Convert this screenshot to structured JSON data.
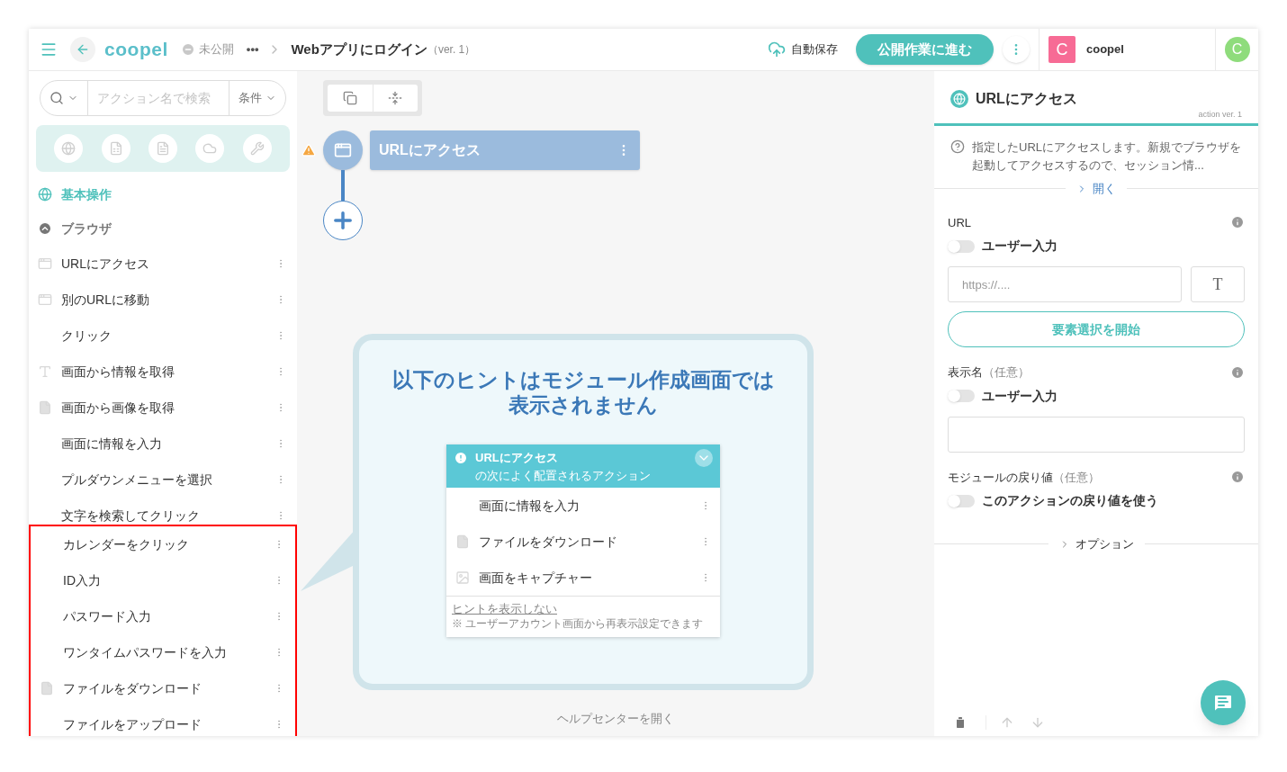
{
  "header": {
    "logo": "coopel",
    "status": "未公開",
    "breadcrumb_more": "•••",
    "title": "Webアプリにログイン",
    "version": "（ver. 1）",
    "autosave": "自動保存",
    "publish_button": "公開作業に進む",
    "account": {
      "initial": "C",
      "name": "coopel"
    },
    "user_initial": "C"
  },
  "sidebar": {
    "search": {
      "placeholder": "アクション名で検索"
    },
    "condition_button": "条件",
    "section": "基本操作",
    "group": {
      "label": "ブラウザ",
      "expanded": true
    },
    "items": [
      {
        "label": "URLにアクセス",
        "kind": "browser",
        "highlighted": false
      },
      {
        "label": "別のURLに移動",
        "kind": "browser",
        "highlighted": false
      },
      {
        "label": "クリック",
        "kind": "plain",
        "highlighted": false
      },
      {
        "label": "画面から情報を取得",
        "kind": "text",
        "highlighted": false
      },
      {
        "label": "画面から画像を取得",
        "kind": "file",
        "highlighted": false
      },
      {
        "label": "画面に情報を入力",
        "kind": "plain",
        "highlighted": false
      },
      {
        "label": "プルダウンメニューを選択",
        "kind": "plain",
        "highlighted": false
      },
      {
        "label": "文字を検索してクリック",
        "kind": "plain",
        "highlighted": false
      },
      {
        "label": "カレンダーをクリック",
        "kind": "plain",
        "highlighted": true
      },
      {
        "label": "ID入力",
        "kind": "plain",
        "highlighted": true
      },
      {
        "label": "パスワード入力",
        "kind": "plain",
        "highlighted": true
      },
      {
        "label": "ワンタイムパスワードを入力",
        "kind": "plain",
        "highlighted": true
      },
      {
        "label": "ファイルをダウンロード",
        "kind": "file",
        "highlighted": true
      },
      {
        "label": "ファイルをアップロード",
        "kind": "plain",
        "highlighted": true
      }
    ]
  },
  "canvas": {
    "node": {
      "label": "URLにアクセス",
      "warning": true
    },
    "hint": {
      "title": "以下のヒントはモジュール作成画面では表示されません",
      "card": {
        "title": "URLにアクセス",
        "subtitle": "の次によく配置されるアクション",
        "items": [
          {
            "label": "画面に情報を入力",
            "kind": "plain"
          },
          {
            "label": "ファイルをダウンロード",
            "kind": "file"
          },
          {
            "label": "画面をキャプチャー",
            "kind": "image"
          }
        ],
        "hide_link": "ヒントを表示しない",
        "note": "※ ユーザーアカウント画面から再表示設定できます"
      }
    },
    "help_link": "ヘルプセンターを開く"
  },
  "panel": {
    "title": "URLにアクセス",
    "version": "action ver. 1",
    "description": "指定したURLにアクセスします。新規でブラウザを起動してアクセスするので、セッション情...",
    "expand_link": "開く",
    "fields": [
      {
        "kind": "url",
        "label": "URL",
        "toggle": {
          "label": "ユーザー入力",
          "on": false
        },
        "placeholder": "https://....",
        "type_button": "T",
        "action_button": "要素選択を開始"
      },
      {
        "kind": "text",
        "label": "表示名",
        "optional": "（任意）",
        "toggle": {
          "label": "ユーザー入力",
          "on": false
        }
      },
      {
        "kind": "return",
        "label": "モジュールの戻り値",
        "optional": "（任意）",
        "toggle": {
          "label": "このアクションの戻り値を使う",
          "on": false
        }
      }
    ],
    "options": "オプション"
  }
}
